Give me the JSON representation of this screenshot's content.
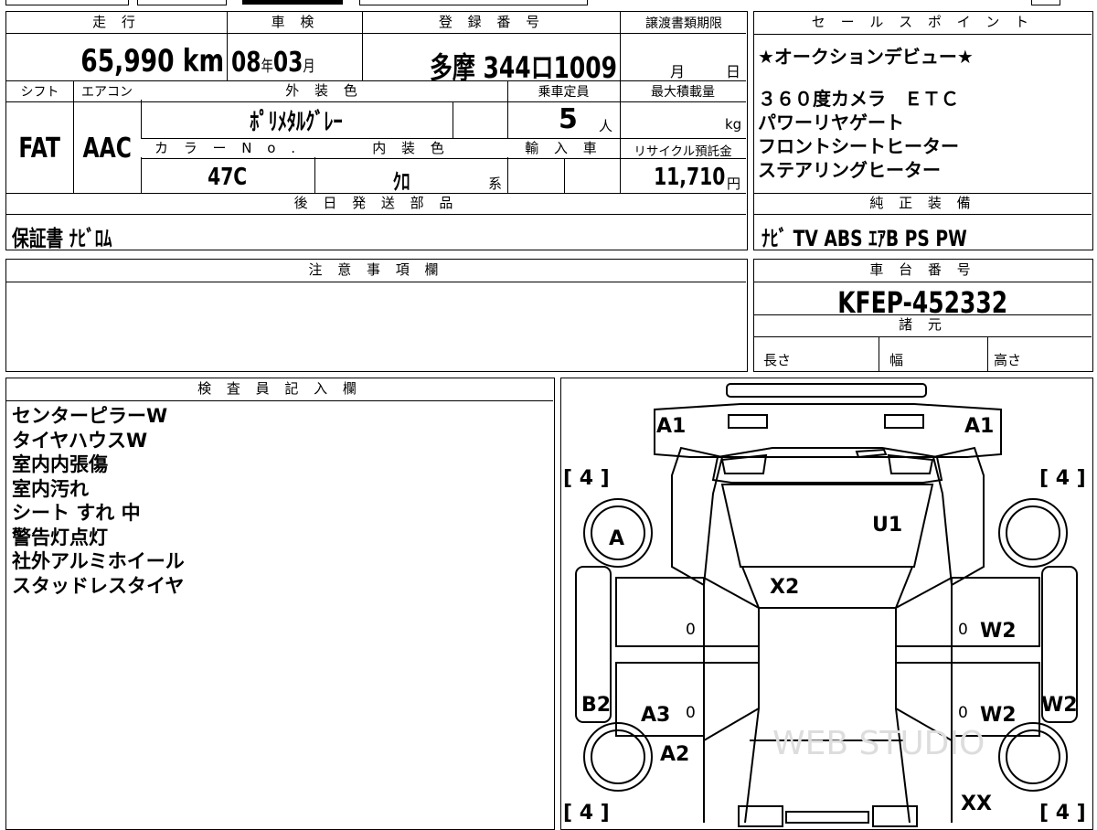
{
  "header": {
    "mileage_label": "走 行",
    "shaken_label": "車 検",
    "reg_label": "登 録 番 号",
    "transfer_label": "譲渡書類期限",
    "sales_label": "セ ー ル ス ポ イ ン ト"
  },
  "row1": {
    "mileage": "65,990 km",
    "shaken_year": "08",
    "year_unit": "年",
    "shaken_month": "03",
    "month_unit": "月",
    "reg_number": "多摩 344ロ1009",
    "transfer_month": "月",
    "transfer_day": "日"
  },
  "row2_labels": {
    "shift": "シフト",
    "aircon": "エアコン",
    "exterior_color": "外 装 色",
    "capacity": "乗車定員",
    "max_load": "最大積載量"
  },
  "row2": {
    "shift": "FAT",
    "aircon": "AAC",
    "exterior_color": "ﾎﾟﾘﾒﾀﾙｸﾞﾚｰ",
    "capacity": "5",
    "capacity_unit": "人",
    "load_unit": "kg"
  },
  "row3_labels": {
    "color_no": "カ ラ ー N o .",
    "interior_color": "内 装 色",
    "import": "輸 入 車",
    "recycle": "リサイクル預託金"
  },
  "row3": {
    "color_no": "47C",
    "interior_color": "ｸﾛ",
    "interior_suffix": "系",
    "recycle_fee": "11,710",
    "recycle_unit": "円"
  },
  "sales_points": [
    "★オークションデビュー★",
    "",
    "３６０度カメラ　ＥＴＣ",
    "パワーリヤゲート",
    "フロントシートヒーター",
    "ステアリングヒーター"
  ],
  "later_parts": {
    "label": "後 日 発 送 部 品",
    "value": "保証書 ﾅﾋﾞﾛﾑ"
  },
  "genuine_equipment": {
    "label": "純 正 装 備",
    "value": "ﾅﾋﾞ TV ABS ｴｱB PS PW"
  },
  "notes": {
    "label": "注 意 事 項 欄",
    "value": ""
  },
  "chassis": {
    "label": "車 台 番 号",
    "value": "KFEP-452332"
  },
  "specs": {
    "label": "諸 元",
    "length": "長さ",
    "width": "幅",
    "height": "高さ"
  },
  "inspector": {
    "label": "検 査 員 記 入 欄",
    "lines": [
      "センターピラーW",
      "タイヤハウスW",
      "室内内張傷",
      "室内汚れ",
      "シート すれ 中",
      "警告灯点灯",
      "社外アルミホイール",
      "スタッドレスタイヤ"
    ]
  },
  "diagram_marks": {
    "a1_left": "A1",
    "a1_right": "A1",
    "u1": "U1",
    "a": "A",
    "x2": "X2",
    "w2_right_upper": "W2",
    "w2_right_lower": "W2",
    "w2_far_right": "W2",
    "b2": "B2",
    "a3": "A3",
    "a2": "A2",
    "xx": "XX",
    "zero_1": "0",
    "zero_2": "0",
    "zero_3": "0",
    "zero_4": "0",
    "tire_fl": "[ 4 ]",
    "tire_fr": "[ 4 ]",
    "tire_rl": "[ 4 ]",
    "tire_rr": "[ 4 ]",
    "watermark": "WEB STUDIO"
  }
}
